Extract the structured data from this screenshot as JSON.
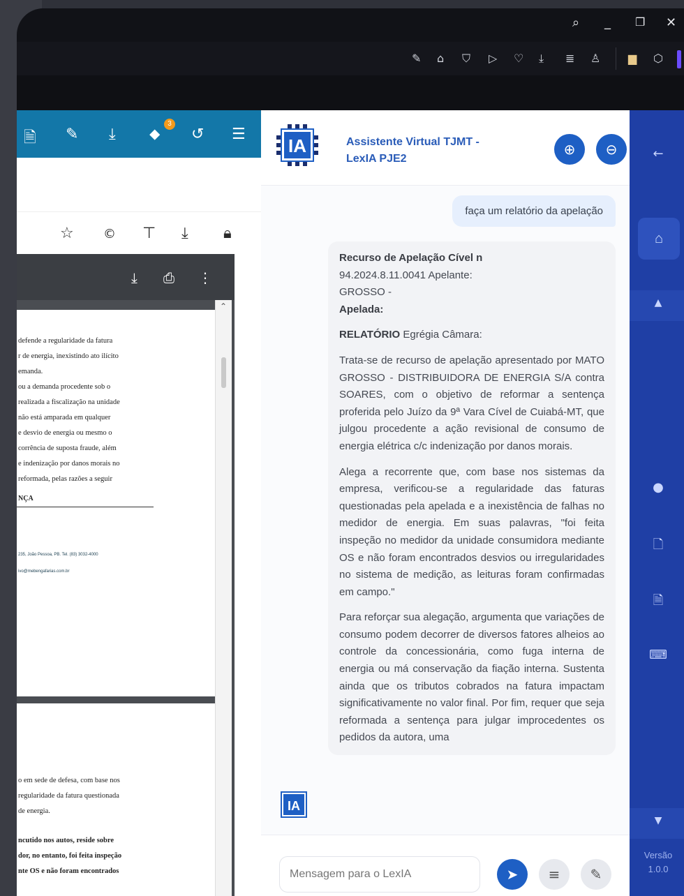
{
  "window": {
    "controls": [
      "search",
      "minimize",
      "restore",
      "close"
    ]
  },
  "toolbar": {
    "icons": [
      "edit-icon",
      "home-icon",
      "shield-icon",
      "play-icon",
      "heart-icon",
      "download-icon",
      "list-icon",
      "user-icon",
      "book-icon",
      "cube-icon"
    ]
  },
  "pdf": {
    "top_icons": [
      "file-icon",
      "edit-icon",
      "download-icon",
      "tag-icon",
      "history-icon",
      "menu-icon"
    ],
    "tag_badge": "3",
    "action_icons": [
      "star-icon",
      "copyright-icon",
      "pin-icon",
      "download-icon",
      "lock-icon"
    ],
    "page1_lines": [
      "defende a regularidade da fatura",
      "r de energia, inexistindo ato ilícito",
      "emanda.",
      "",
      "ou a demanda procedente sob o",
      "realizada a fiscalização na unidade",
      "não está amparada em qualquer",
      "e desvio de energia ou mesmo o",
      "corrência de suposta fraude, além",
      "e indenização por danos morais no",
      "",
      "reformada, pelas razões a seguir"
    ],
    "page1_section": "NÇA",
    "page1_footer": [
      "235, João Pessoa, PB. Tel. (83) 3032-4000",
      "ivo@mebengafarias.com.br"
    ],
    "page2_lines": [
      "o em sede de defesa, com base nos",
      "regularidade da fatura questionada",
      "de energia."
    ],
    "page2_bold_lines": [
      "ncutido nos autos, reside sobre",
      "dor, no entanto, foi feita inspeção",
      "nte OS e não foram encontrados"
    ]
  },
  "chat": {
    "title_line1": "Assistente Virtual TJMT -",
    "title_line2": "LexIA PJE2",
    "logo_text": "IA",
    "user_message": "faça um relatório da apelação",
    "bot_heading": "Recurso de Apelação Cível n",
    "bot_heading_rest": "94.2024.8.11.0041 Apelante:",
    "bot_heading_rest2": "GROSSO -",
    "bot_apelada": "Apelada:",
    "bot_relatorio_label": "RELATÓRIO",
    "bot_relatorio_text": "Egrégia Câmara:",
    "bot_p1": "Trata-se de recurso de apelação apresentado por MATO GROSSO - DISTRIBUIDORA DE ENERGIA S/A contra SOARES, com o objetivo de reformar a sentença proferida pelo Juízo da 9ª Vara Cível de Cuiabá-MT, que julgou procedente a ação revisional de consumo de energia elétrica c/c indenização por danos morais.",
    "bot_p2": "Alega a recorrente que, com base nos sistemas da empresa, verificou-se a regularidade das faturas questionadas pela apelada e a inexistência de falhas no medidor de energia. Em suas palavras, \"foi feita inspeção no medidor da unidade consumidora mediante OS e não foram encontrados desvios ou irregularidades no sistema de medição, as leituras foram confirmadas em campo.\"",
    "bot_p3": "Para reforçar sua alegação, argumenta que variações de consumo podem decorrer de diversos fatores alheios ao controle da concessionária, como fuga interna de energia ou má conservação da fiação interna. Sustenta ainda que os tributos cobrados na fatura impactam significativamente no valor final. Por fim, requer que seja reformada a sentença para julgar improcedentes os pedidos da autora, uma",
    "input_placeholder": "Mensagem para o LexIA"
  },
  "sidebar": {
    "version_label": "Versão",
    "version_value": "1.0.0"
  },
  "colors": {
    "pdf_header": "#1377a8",
    "chat_accent": "#1e5fc4",
    "sidebar": "#1f3fa5",
    "badge": "#f39a1c"
  }
}
